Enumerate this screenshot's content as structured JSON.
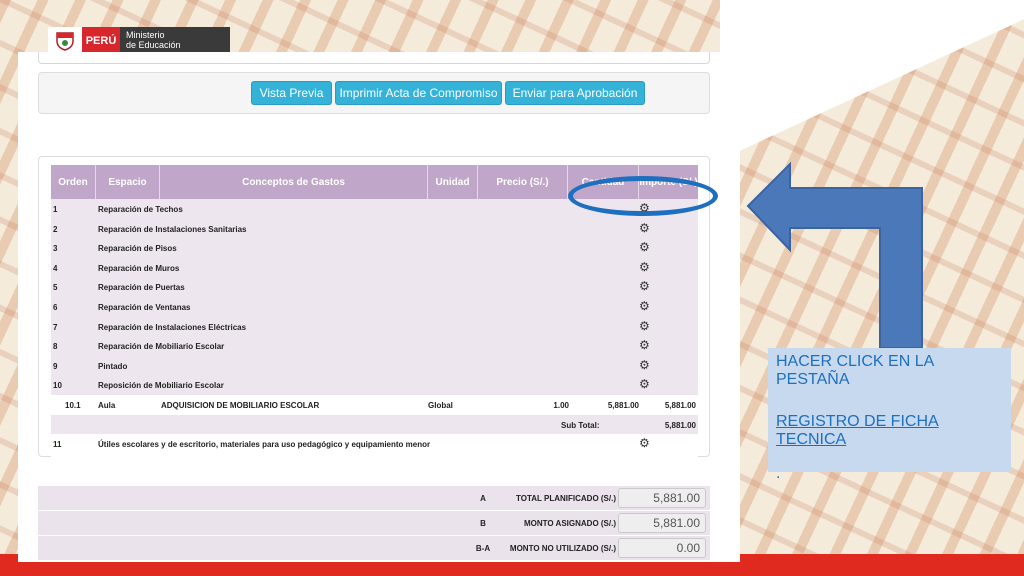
{
  "header": {
    "country": "PERÚ",
    "ministry_line1": "Ministerio",
    "ministry_line2": "de Educación"
  },
  "toolbar": {
    "preview_label": "Vista Previa",
    "print_label": "Imprimir Acta de Compromiso",
    "send_label": "Enviar para Aprobación"
  },
  "table": {
    "columns": [
      "Orden",
      "Espacio",
      "Conceptos de Gastos",
      "Unidad",
      "Precio (S/.)",
      "Cantidad",
      "Importe (S/.)"
    ],
    "rows": [
      {
        "orden": "1",
        "concepto": "Reparación de Techos"
      },
      {
        "orden": "2",
        "concepto": "Reparación de Instalaciones Sanitarias"
      },
      {
        "orden": "3",
        "concepto": "Reparación de Pisos"
      },
      {
        "orden": "4",
        "concepto": "Reparación de Muros"
      },
      {
        "orden": "5",
        "concepto": "Reparación de Puertas"
      },
      {
        "orden": "6",
        "concepto": "Reparación de Ventanas"
      },
      {
        "orden": "7",
        "concepto": "Reparación de Instalaciones Eléctricas"
      },
      {
        "orden": "8",
        "concepto": "Reparación de Mobiliario Escolar"
      },
      {
        "orden": "9",
        "concepto": "Pintado"
      },
      {
        "orden": "10",
        "concepto": "Reposición de Mobiliario Escolar"
      }
    ],
    "detail": {
      "orden": "10.1",
      "espacio": "Aula",
      "concepto": "ADQUISICION DE MOBILIARIO ESCOLAR",
      "unidad": "Global",
      "cantidad": "1.00",
      "precio": "5,881.00",
      "importe": "5,881.00"
    },
    "subtotal": {
      "label": "Sub Total:",
      "value": "5,881.00"
    },
    "last_row": {
      "orden": "11",
      "concepto": "Útiles escolares y de escritorio, materiales para uso pedagógico y equipamiento menor"
    }
  },
  "totals": [
    {
      "code": "A",
      "label": "TOTAL PLANIFICADO (S/.)",
      "value": "5,881.00"
    },
    {
      "code": "B",
      "label": "MONTO ASIGNADO (S/.)",
      "value": "5,881.00"
    },
    {
      "code": "B-A",
      "label": "MONTO NO UTILIZADO (S/.)",
      "value": "0.00"
    }
  ],
  "callout": {
    "line1": "HACER CLICK EN LA PESTAÑA",
    "line2": "REGISTRO DE FICHA TECNICA",
    "line3": "."
  },
  "colors": {
    "button": "#35b2d8",
    "table_header": "#c0a6c9",
    "annotation": "#1f6fbf",
    "arrow_fill": "#4a78b8",
    "callout_bg": "#c6d9ef",
    "brand_red": "#e02a20"
  },
  "icons": {
    "row_action": "gear-icon",
    "shield": "peru-shield-icon"
  }
}
